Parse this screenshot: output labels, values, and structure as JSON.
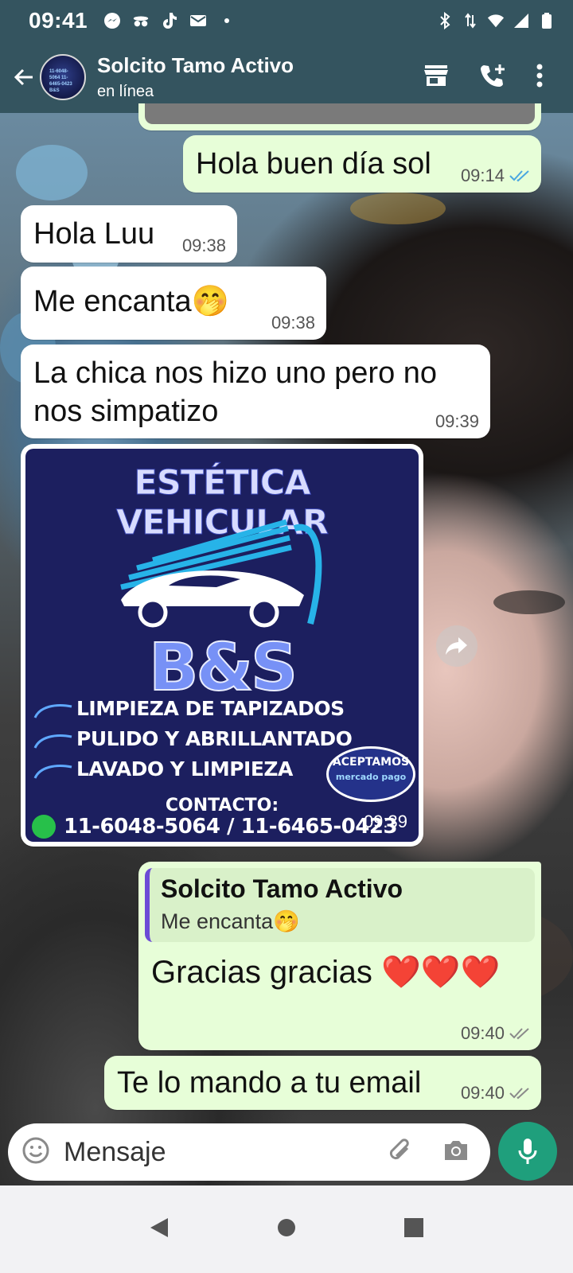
{
  "status_bar": {
    "time": "09:41"
  },
  "header": {
    "contact_name": "Solcito Tamo Activo",
    "contact_status": "en línea",
    "avatar_text": "11-6048-5064 11-6465-0423 B&S"
  },
  "messages": [
    {
      "id": "m1",
      "direction": "out",
      "text": "Hola buen día sol",
      "time": "09:14",
      "ticks": "read"
    },
    {
      "id": "m2",
      "direction": "in",
      "text": "Hola Luu",
      "time": "09:38"
    },
    {
      "id": "m3",
      "direction": "in",
      "text": "Me encanta🤭",
      "time": "09:38"
    },
    {
      "id": "m4",
      "direction": "in",
      "text": "La chica nos hizo uno pero no nos simpatizo",
      "time": "09:39"
    },
    {
      "id": "m5",
      "direction": "in",
      "type": "image",
      "time": "09:39",
      "poster": {
        "title": "ESTÉTICA VEHICULAR",
        "brand": "B&S",
        "services": [
          "LIMPIEZA DE TAPIZADOS",
          "PULIDO Y ABRILLANTADO",
          "LAVADO Y LIMPIEZA"
        ],
        "badge_top": "ACEPTAMOS",
        "badge_sub": "mercado pago",
        "contact_label": "CONTACTO:",
        "contact_numbers": "11-6048-5064 / 11-6465-0423"
      }
    },
    {
      "id": "m6",
      "direction": "out",
      "time": "09:40",
      "ticks": "delivered",
      "quote_name": "Solcito Tamo Activo",
      "quote_text": "Me encanta🤭",
      "text": "Gracias gracias ❤️❤️❤️"
    },
    {
      "id": "m7",
      "direction": "out",
      "text": "Te lo mando a tu email",
      "time": "09:40",
      "ticks": "delivered"
    }
  ],
  "composer": {
    "placeholder": "Mensaje"
  },
  "colors": {
    "header_bg": "#34545f",
    "outgoing_bubble": "#e7fed8",
    "incoming_bubble": "#ffffff",
    "accent_green": "#1f9f7c",
    "read_ticks": "#4aa7e0"
  }
}
